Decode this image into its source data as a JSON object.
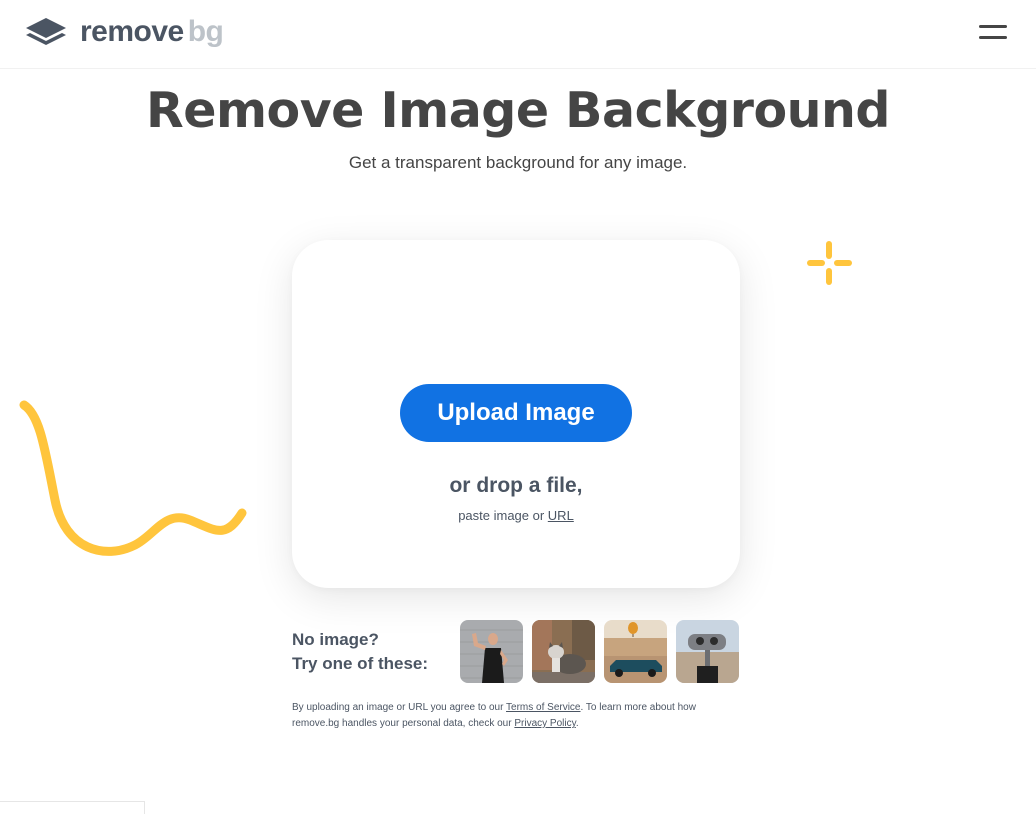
{
  "header": {
    "logo_word1": "remove",
    "logo_word2": "bg",
    "menu_icon": "hamburger-icon"
  },
  "hero": {
    "title": "Remove Image Background",
    "subtitle": "Get a transparent background for any image."
  },
  "upload": {
    "button_label": "Upload Image",
    "drop_text": "or drop a file,",
    "paste_prefix": "paste image or ",
    "url_link": "URL"
  },
  "samples": {
    "line1": "No image?",
    "line2": "Try one of these:",
    "items": [
      {
        "label": "woman-flexing"
      },
      {
        "label": "cat"
      },
      {
        "label": "car-with-balloon"
      },
      {
        "label": "binoculars"
      }
    ]
  },
  "legal": {
    "part1": "By uploading an image or URL you agree to our ",
    "terms_link": "Terms of Service",
    "part2": ". To learn more about how remove.bg handles your personal data, check our ",
    "privacy_link": "Privacy Policy",
    "part3": "."
  },
  "colors": {
    "accent": "#1172e3",
    "decoration": "#ffc53d",
    "text": "#454545",
    "muted": "#4b5563"
  }
}
